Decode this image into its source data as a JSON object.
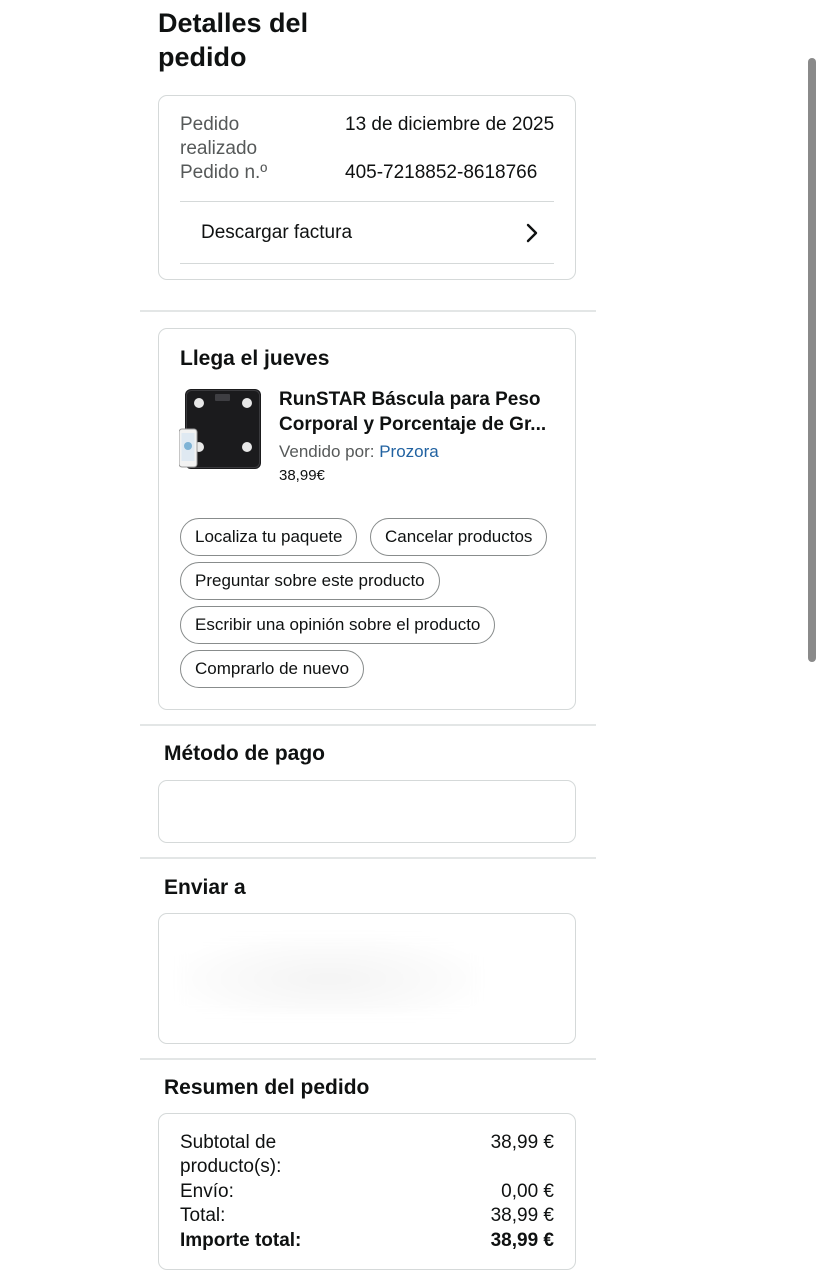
{
  "page": {
    "title": "Detalles del pedido"
  },
  "order_info": {
    "placed_label": "Pedido realizado",
    "placed_value": "13 de diciembre de 2025",
    "number_label": "Pedido n.º",
    "number_value": "405-7218852-8618766",
    "invoice_link": "Descargar factura",
    "invoice_icon": "chevron-right-icon"
  },
  "shipment": {
    "heading": "Llega el jueves",
    "product_title": "RunSTAR Báscula para Peso Corporal y Porcentaje de Gr...",
    "sold_by_label": "Vendido por:",
    "seller": "Prozora",
    "price": "38,99€",
    "actions": {
      "track": "Localiza tu paquete",
      "cancel": "Cancelar productos",
      "ask": "Preguntar sobre este producto",
      "review": "Escribir una opinión sobre el producto",
      "buy_again": "Comprarlo de nuevo"
    }
  },
  "payment": {
    "heading": "Método de pago"
  },
  "shipping": {
    "heading": "Enviar a"
  },
  "summary": {
    "heading": "Resumen del pedido",
    "subtotal_label": "Subtotal de producto(s):",
    "subtotal_value": "38,99 €",
    "shipping_label": "Envío:",
    "shipping_value": "0,00 €",
    "total_label": "Total:",
    "total_value": "38,99 €",
    "grand_total_label": "Importe total:",
    "grand_total_value": "38,99 €"
  },
  "colors": {
    "seller_link": "#2162a1",
    "border": "#d5d9d9",
    "pill_border": "#888c8c",
    "text": "#0f1111",
    "muted": "#565959"
  }
}
